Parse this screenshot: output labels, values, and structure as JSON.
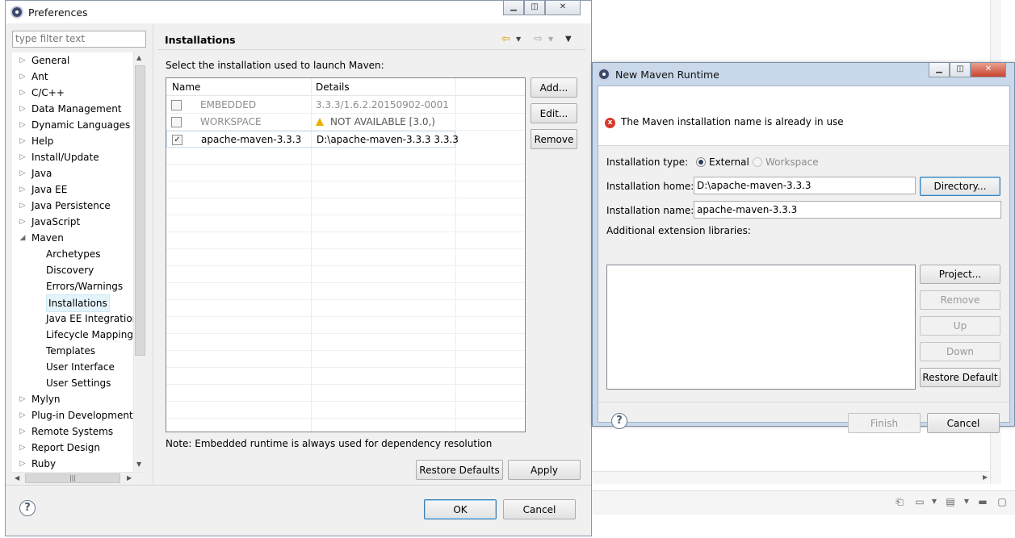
{
  "preferences": {
    "title": "Preferences",
    "filter_placeholder": "type filter text",
    "tree": [
      {
        "label": "General",
        "level": 0,
        "expanded": false
      },
      {
        "label": "Ant",
        "level": 0,
        "expanded": false
      },
      {
        "label": "C/C++",
        "level": 0,
        "expanded": false
      },
      {
        "label": "Data Management",
        "level": 0,
        "expanded": false
      },
      {
        "label": "Dynamic Languages",
        "level": 0,
        "expanded": false
      },
      {
        "label": "Help",
        "level": 0,
        "expanded": false
      },
      {
        "label": "Install/Update",
        "level": 0,
        "expanded": false
      },
      {
        "label": "Java",
        "level": 0,
        "expanded": false
      },
      {
        "label": "Java EE",
        "level": 0,
        "expanded": false
      },
      {
        "label": "Java Persistence",
        "level": 0,
        "expanded": false
      },
      {
        "label": "JavaScript",
        "level": 0,
        "expanded": false
      },
      {
        "label": "Maven",
        "level": 0,
        "expanded": true
      },
      {
        "label": "Archetypes",
        "level": 1
      },
      {
        "label": "Discovery",
        "level": 1
      },
      {
        "label": "Errors/Warnings",
        "level": 1
      },
      {
        "label": "Installations",
        "level": 1,
        "selected": true
      },
      {
        "label": "Java EE Integration",
        "level": 1
      },
      {
        "label": "Lifecycle Mapping",
        "level": 1
      },
      {
        "label": "Templates",
        "level": 1
      },
      {
        "label": "User Interface",
        "level": 1
      },
      {
        "label": "User Settings",
        "level": 1
      },
      {
        "label": "Mylyn",
        "level": 0,
        "expanded": false
      },
      {
        "label": "Plug-in Development",
        "level": 0,
        "expanded": false
      },
      {
        "label": "Remote Systems",
        "level": 0,
        "expanded": false
      },
      {
        "label": "Report Design",
        "level": 0,
        "expanded": false
      },
      {
        "label": "Ruby",
        "level": 0,
        "expanded": false
      }
    ],
    "page_title": "Installations",
    "description": "Select the installation used to launch Maven:",
    "table": {
      "columns": [
        "Name",
        "Details"
      ],
      "rows": [
        {
          "checked": false,
          "name": "EMBEDDED",
          "details": "3.3.3/1.6.2.20150902-0001",
          "disabled": true,
          "warning": false
        },
        {
          "checked": false,
          "name": "WORKSPACE",
          "details": "NOT AVAILABLE [3.0,)",
          "disabled": true,
          "warning": true
        },
        {
          "checked": true,
          "name": "apache-maven-3.3.3",
          "details": "D:\\apache-maven-3.3.3 3.3.3",
          "disabled": false,
          "warning": false
        }
      ]
    },
    "buttons": {
      "add": "Add...",
      "edit": "Edit...",
      "remove": "Remove",
      "restore_defaults": "Restore Defaults",
      "apply": "Apply",
      "ok": "OK",
      "cancel": "Cancel"
    },
    "note": "Note: Embedded runtime is always used for dependency resolution"
  },
  "maven_runtime": {
    "title": "New Maven Runtime",
    "error_message": "The Maven installation name is already in use",
    "installation_type_label": "Installation type:",
    "type_external": "External",
    "type_workspace": "Workspace",
    "installation_home_label": "Installation home:",
    "installation_home_value": "D:\\apache-maven-3.3.3",
    "installation_name_label": "Installation name:",
    "installation_name_value": "apache-maven-3.3.3",
    "additional_libs_label": "Additional extension libraries:",
    "buttons": {
      "directory": "Directory...",
      "project": "Project...",
      "remove": "Remove",
      "up": "Up",
      "down": "Down",
      "restore_default": "Restore Default",
      "finish": "Finish",
      "cancel": "Cancel"
    }
  },
  "icons": {
    "help": "?",
    "error": "x",
    "back": "⇦",
    "forward": "⇨",
    "menu": "▼"
  }
}
